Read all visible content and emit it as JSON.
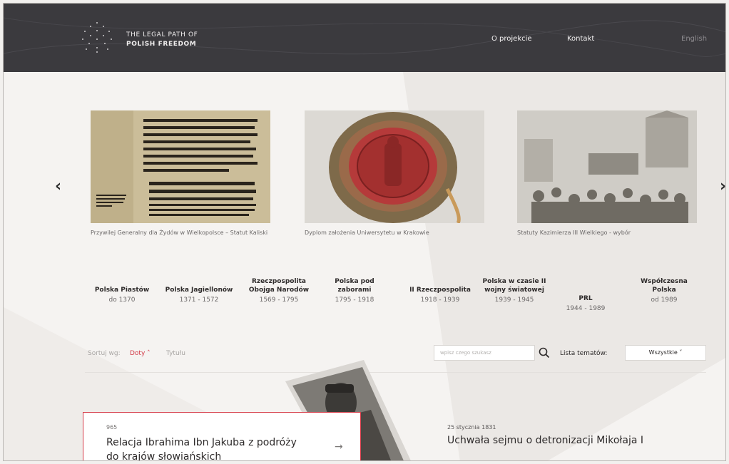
{
  "header": {
    "logo_line1": "THE LEGAL PATH OF",
    "logo_line2": "POLISH FREEDOM",
    "nav": [
      "O projekcie",
      "Kontakt"
    ],
    "language": "English"
  },
  "carousel": {
    "prev_icon": "chevron-left-icon",
    "next_icon": "chevron-right-icon",
    "slides": [
      {
        "caption": "Przywilej Generalny dla Żydów w Wielkopolsce – Statut Kaliski"
      },
      {
        "caption": "Dyplom założenia Uniwersytetu w Krakowie"
      },
      {
        "caption": "Statuty Kazimierza III Wielkiego - wybór"
      }
    ]
  },
  "eras": [
    {
      "name": "Polska Piastów",
      "dates": "do 1370"
    },
    {
      "name": "Polska Jagiellonów",
      "dates": "1371 - 1572"
    },
    {
      "name": "Rzeczpospolita Obojga Narodów",
      "dates": "1569 - 1795"
    },
    {
      "name": "Polska pod zaborami",
      "dates": "1795 - 1918"
    },
    {
      "name": "II Rzeczpospolita",
      "dates": "1918 - 1939"
    },
    {
      "name": "Polska w czasie II wojny światowej",
      "dates": "1939 - 1945"
    },
    {
      "name": "PRL",
      "dates": "1944 - 1989"
    },
    {
      "name": "Współczesna Polska",
      "dates": "od 1989"
    }
  ],
  "filters": {
    "sort_label": "Sortuj wg:",
    "sort_by_date": "Doty",
    "sort_by_title": "Tytułu",
    "search_placeholder": "wpisz czego szukasz",
    "topics_label": "Lista tematów:",
    "topics_selected": "Wszystkie"
  },
  "entries": [
    {
      "date": "965",
      "title": "Relacja Ibrahima Ibn Jakuba z podróży do krajów słowiańskich"
    },
    {
      "date": "25 stycznia 1831",
      "title": "Uchwała sejmu o detronizacji Mikołaja I"
    }
  ],
  "colors": {
    "header_bg": "#3b3a3e",
    "accent": "#d23a47",
    "page_bg": "#f5f3f1"
  }
}
